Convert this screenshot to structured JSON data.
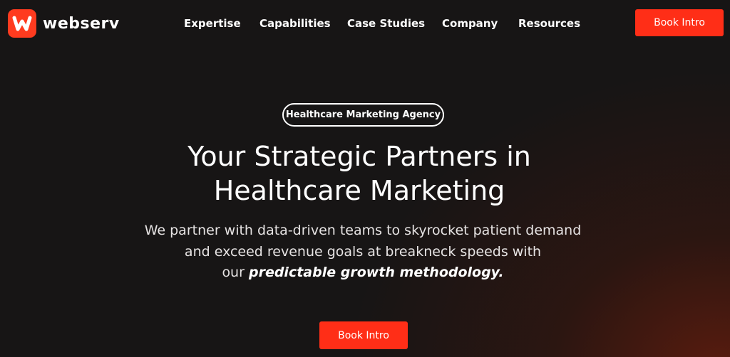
{
  "brand": {
    "name": "webserv",
    "logo_icon": "w-logo-icon",
    "accent_color": "#ff2e17"
  },
  "nav": {
    "items": [
      {
        "label": "Expertise"
      },
      {
        "label": "Capabilities"
      },
      {
        "label": "Case Studies"
      },
      {
        "label": "Company"
      },
      {
        "label": "Resources"
      }
    ],
    "cta_label": "Book Intro"
  },
  "hero": {
    "badge": "Healthcare Marketing Agency",
    "title_lines": [
      "Your Strategic Partners in",
      "Healthcare Marketing"
    ],
    "subtitle": {
      "line1": "We partner with data-driven teams to skyrocket patient demand",
      "line2": "and exceed revenue goals at breakneck speeds with",
      "line3_prefix": "our ",
      "line3_emphasis": "predictable growth methodology",
      "line3_suffix": "."
    },
    "cta_label": "Book Intro"
  }
}
